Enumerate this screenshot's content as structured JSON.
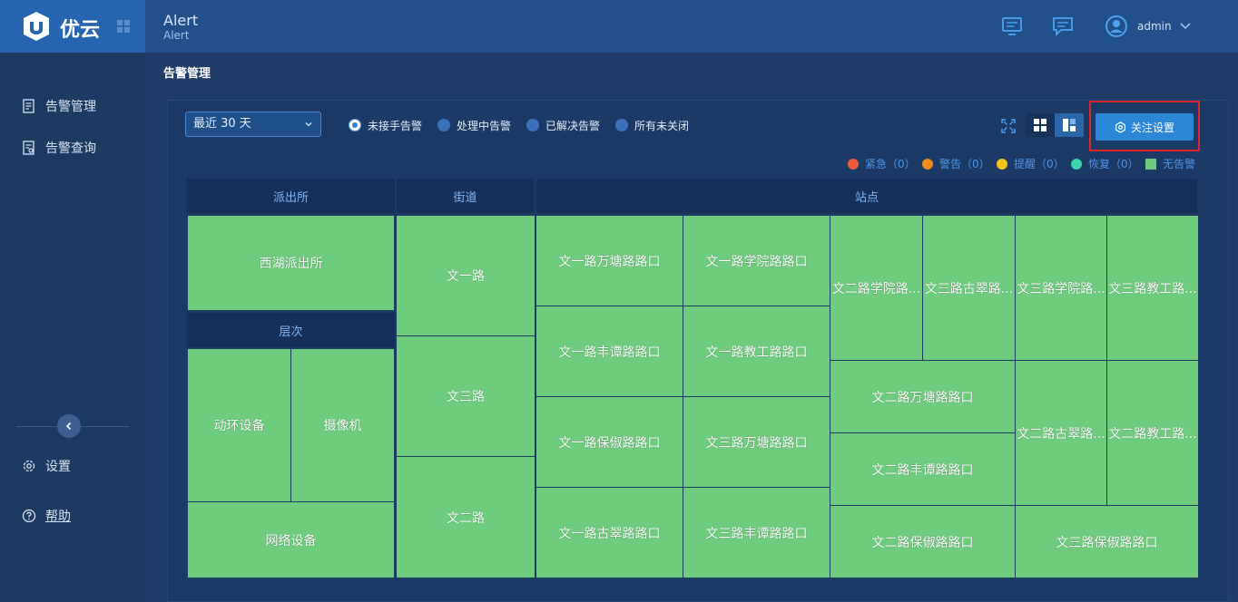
{
  "brand": {
    "name": "优云"
  },
  "header": {
    "title": "Alert",
    "subtitle": "Alert",
    "user": "admin"
  },
  "sidebar": {
    "items": [
      {
        "label": "告警管理",
        "icon": "doc-icon"
      },
      {
        "label": "告警查询",
        "icon": "doc-search-icon"
      }
    ],
    "bottom": [
      {
        "label": "设置",
        "icon": "gear-icon"
      },
      {
        "label": "帮助",
        "icon": "help-icon"
      }
    ]
  },
  "page": {
    "title": "告警管理"
  },
  "filters": {
    "range": "最近 30 天",
    "radios": [
      {
        "label": "未接手告警",
        "selected": true
      },
      {
        "label": "处理中告警",
        "selected": false
      },
      {
        "label": "已解决告警",
        "selected": false
      },
      {
        "label": "所有未关闭",
        "selected": false
      }
    ],
    "focus_button": "关注设置"
  },
  "legend": [
    {
      "label": "紧急（0）",
      "color": "#ee5a3c"
    },
    {
      "label": "警告（0）",
      "color": "#f08a1c"
    },
    {
      "label": "提醒（0）",
      "color": "#f2c318"
    },
    {
      "label": "恢复（0）",
      "color": "#3fd4a9"
    },
    {
      "label": "无告警",
      "color": "#6ecc7c"
    }
  ],
  "treemap": {
    "headers": {
      "police": "派出所",
      "street": "街道",
      "site": "站点",
      "level": "层次"
    },
    "police": "西湖派出所",
    "devices": [
      "动环设备",
      "摄像机",
      "网络设备"
    ],
    "streets": [
      "文一路",
      "文三路",
      "文二路"
    ],
    "sites": [
      "文一路万塘路路口",
      "文一路学院路路口",
      "文一路丰谭路路口",
      "文一路教工路路口",
      "文一路保俶路路口",
      "文三路万塘路路口",
      "文一路古翠路路口",
      "文三路丰谭路路口",
      "文二路学院路...",
      "文三路古翠路...",
      "文三路学院路...",
      "文三路教工路...",
      "文二路万塘路路口",
      "文二路丰谭路路口",
      "文二路古翠路...",
      "文二路教工路...",
      "文二路保俶路路口",
      "文三路保俶路路口"
    ]
  }
}
